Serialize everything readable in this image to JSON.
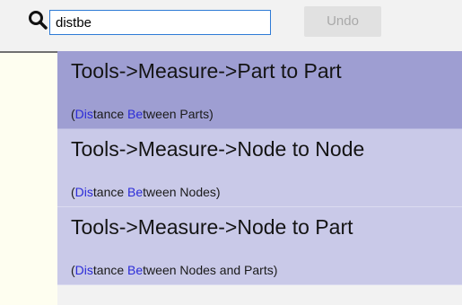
{
  "search": {
    "value": "distbe"
  },
  "toolbar": {
    "undo_label": "Undo"
  },
  "suggestions": [
    {
      "command": "Tools->Measure->Part to Part",
      "description": {
        "open": "(",
        "hl1": "Dis",
        "mid1": "tance ",
        "hl2": "Be",
        "rest": "tween Parts)"
      }
    },
    {
      "command": "Tools->Measure->Node to Node",
      "description": {
        "open": "(",
        "hl1": "Dis",
        "mid1": "tance ",
        "hl2": "Be",
        "rest": "tween Nodes)"
      }
    },
    {
      "command": "Tools->Measure->Node to Part",
      "description": {
        "open": "(",
        "hl1": "Dis",
        "mid1": "tance ",
        "hl2": "Be",
        "rest": "tween Nodes and Parts)"
      }
    }
  ],
  "colors": {
    "selected_bg": "#9e9ed2",
    "item_bg": "#c9c9e8",
    "match_highlight": "#2b2bd8",
    "input_border": "#2e7bd6"
  }
}
